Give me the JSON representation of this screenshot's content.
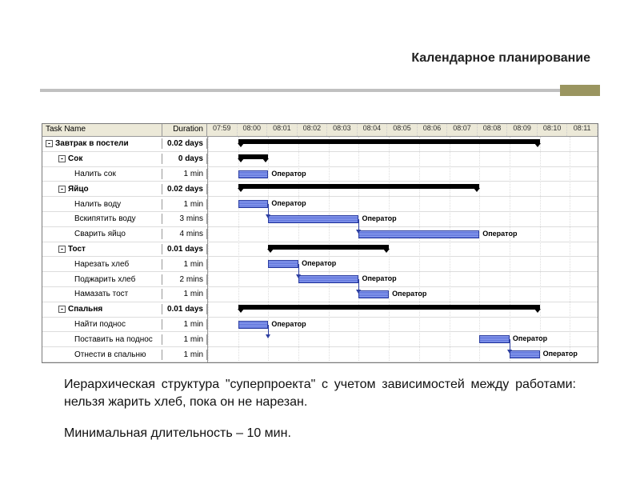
{
  "slide": {
    "title": "Календарное планирование",
    "caption1": "Иерархическая структура \"суперпроекта\" с учетом зависимостей между работами: нельзя жарить хлеб, пока он не нарезан.",
    "caption2": "Минимальная длительность – 10 мин."
  },
  "gantt": {
    "header_task": "Task Name",
    "header_dur": "Duration",
    "timeline": [
      "07:59",
      "08:00",
      "08:01",
      "08:02",
      "08:03",
      "08:04",
      "08:05",
      "08:06",
      "08:07",
      "08:08",
      "08:09",
      "08:10",
      "08:11"
    ],
    "rows": [
      {
        "level": 0,
        "name": "Завтрак в постели",
        "dur": "0.02 days",
        "expand": true
      },
      {
        "level": 1,
        "name": "Сок",
        "dur": "0 days",
        "expand": true
      },
      {
        "level": 2,
        "name": "Налить сок",
        "dur": "1 min",
        "assignee": "Оператор"
      },
      {
        "level": 1,
        "name": "Яйцо",
        "dur": "0.02 days",
        "expand": true
      },
      {
        "level": 2,
        "name": "Налить воду",
        "dur": "1 min",
        "assignee": "Оператор"
      },
      {
        "level": 2,
        "name": "Вскипятить воду",
        "dur": "3 mins",
        "assignee": "Оператор"
      },
      {
        "level": 2,
        "name": "Сварить яйцо",
        "dur": "4 mins",
        "assignee": "Оператор"
      },
      {
        "level": 1,
        "name": "Тост",
        "dur": "0.01 days",
        "expand": true
      },
      {
        "level": 2,
        "name": "Нарезать хлеб",
        "dur": "1 min",
        "assignee": "Оператор"
      },
      {
        "level": 2,
        "name": "Поджарить хлеб",
        "dur": "2 mins",
        "assignee": "Оператор"
      },
      {
        "level": 2,
        "name": "Намазать тост",
        "dur": "1 min",
        "assignee": "Оператор"
      },
      {
        "level": 1,
        "name": "Спальня",
        "dur": "0.01 days",
        "expand": true
      },
      {
        "level": 2,
        "name": "Найти поднос",
        "dur": "1 min",
        "assignee": "Оператор"
      },
      {
        "level": 2,
        "name": "Поставить на поднос",
        "dur": "1 min",
        "assignee": "Оператор"
      },
      {
        "level": 2,
        "name": "Отнести в спальню",
        "dur": "1 min",
        "assignee": "Оператор"
      }
    ]
  },
  "chart_data": {
    "type": "gantt",
    "time_unit": "minutes after 08:00",
    "tasks": [
      {
        "name": "Завтрак в постели",
        "type": "summary",
        "start": 0,
        "end": 10
      },
      {
        "name": "Сок",
        "type": "summary",
        "start": 0,
        "end": 1
      },
      {
        "name": "Налить сок",
        "type": "task",
        "start": 0,
        "end": 1,
        "assignee": "Оператор"
      },
      {
        "name": "Яйцо",
        "type": "summary",
        "start": 0,
        "end": 8
      },
      {
        "name": "Налить воду",
        "type": "task",
        "start": 0,
        "end": 1,
        "assignee": "Оператор"
      },
      {
        "name": "Вскипятить воду",
        "type": "task",
        "start": 1,
        "end": 4,
        "assignee": "Оператор",
        "predecessor": "Налить воду"
      },
      {
        "name": "Сварить яйцо",
        "type": "task",
        "start": 4,
        "end": 8,
        "assignee": "Оператор",
        "predecessor": "Вскипятить воду"
      },
      {
        "name": "Тост",
        "type": "summary",
        "start": 1,
        "end": 5
      },
      {
        "name": "Нарезать хлеб",
        "type": "task",
        "start": 1,
        "end": 2,
        "assignee": "Оператор"
      },
      {
        "name": "Поджарить хлеб",
        "type": "task",
        "start": 2,
        "end": 4,
        "assignee": "Оператор",
        "predecessor": "Нарезать хлеб"
      },
      {
        "name": "Намазать тост",
        "type": "task",
        "start": 4,
        "end": 5,
        "assignee": "Оператор",
        "predecessor": "Поджарить хлеб"
      },
      {
        "name": "Спальня",
        "type": "summary",
        "start": 0,
        "end": 10
      },
      {
        "name": "Найти поднос",
        "type": "task",
        "start": 0,
        "end": 1,
        "assignee": "Оператор"
      },
      {
        "name": "Поставить на поднос",
        "type": "task",
        "start": 8,
        "end": 9,
        "assignee": "Оператор",
        "predecessor": "Найти поднос"
      },
      {
        "name": "Отнести в спальню",
        "type": "task",
        "start": 9,
        "end": 10,
        "assignee": "Оператор",
        "predecessor": "Поставить на поднос"
      }
    ]
  }
}
